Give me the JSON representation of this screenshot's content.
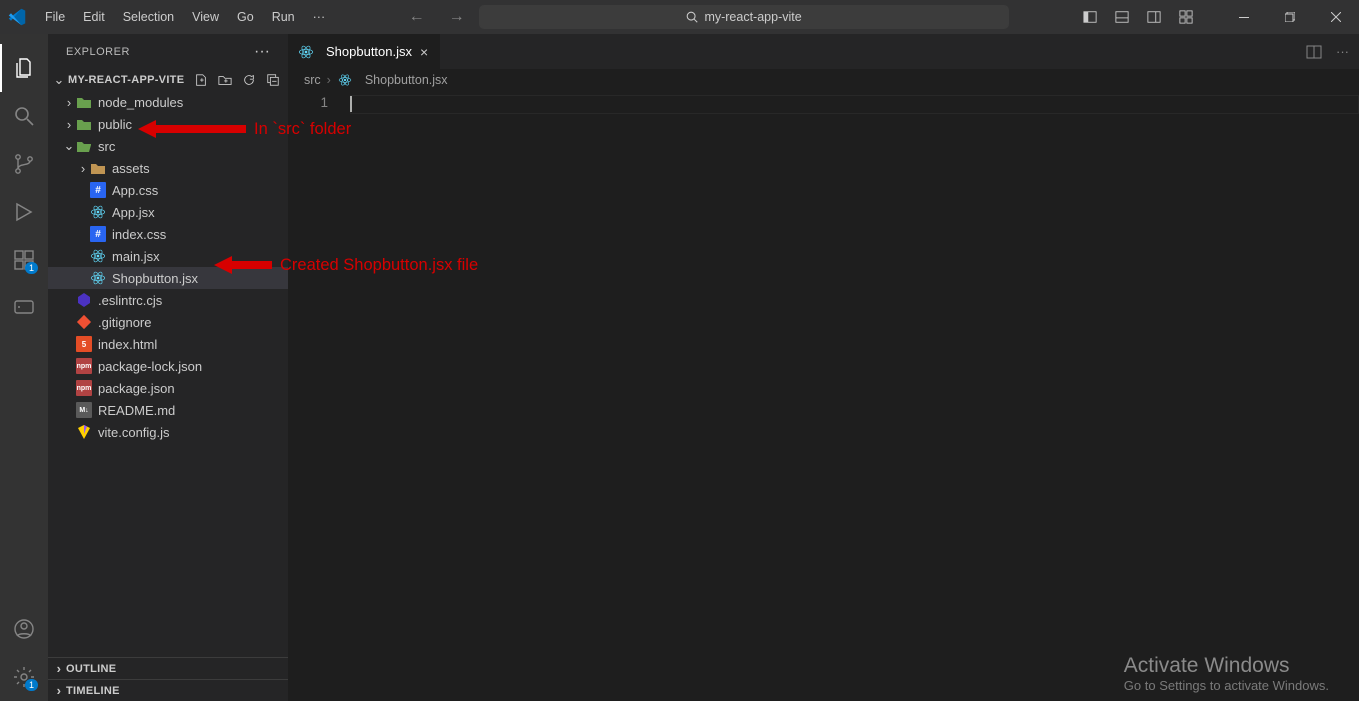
{
  "menu": [
    "File",
    "Edit",
    "Selection",
    "View",
    "Go",
    "Run",
    "···"
  ],
  "search": {
    "text": "my-react-app-vite"
  },
  "sidebar": {
    "title": "EXPLORER",
    "project": "MY-REACT-APP-VITE",
    "outline": "OUTLINE",
    "timeline": "TIMELINE"
  },
  "tree": {
    "node_modules": "node_modules",
    "public": "public",
    "src": "src",
    "assets": "assets",
    "app_css": "App.css",
    "app_jsx": "App.jsx",
    "index_css": "index.css",
    "main_jsx": "main.jsx",
    "shopbutton": "Shopbutton.jsx",
    "eslint": ".eslintrc.cjs",
    "gitignore": ".gitignore",
    "indexhtml": "index.html",
    "pkglock": "package-lock.json",
    "pkg": "package.json",
    "readme": "README.md",
    "vitecfg": "vite.config.js"
  },
  "tab": {
    "name": "Shopbutton.jsx"
  },
  "breadcrumb": {
    "p0": "src",
    "p1": "Shopbutton.jsx"
  },
  "gutter": {
    "line1": "1"
  },
  "annotations": {
    "src": "In `src` folder",
    "file": "Created Shopbutton.jsx file"
  },
  "watermark": {
    "l1": "Activate Windows",
    "l2": "Go to Settings to activate Windows."
  },
  "badges": {
    "ext": "1",
    "settings": "1"
  }
}
